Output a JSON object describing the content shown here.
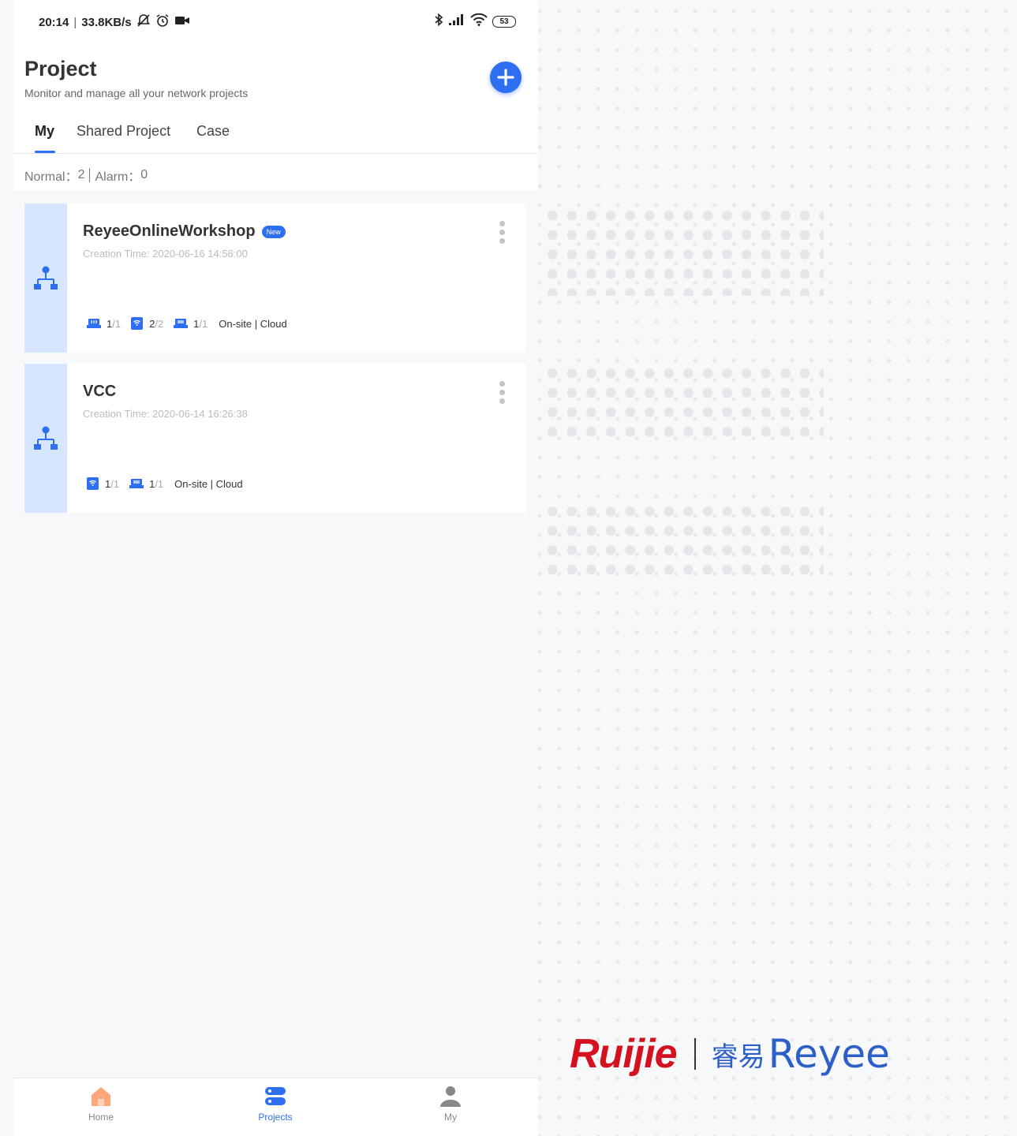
{
  "status_bar": {
    "time": "20:14",
    "speed": "33.8KB/s",
    "battery": "53",
    "icons": [
      "muted-bell-icon",
      "alarm-icon",
      "video-icon",
      "bluetooth-icon",
      "signal-icon",
      "wifi-icon",
      "battery-icon"
    ]
  },
  "header": {
    "title": "Project",
    "subtitle": "Monitor and manage all your network projects",
    "add_icon": "plus-icon"
  },
  "tabs": [
    {
      "label": "My",
      "active": true
    },
    {
      "label": "Shared Project",
      "active": false
    },
    {
      "label": "Case",
      "active": false
    }
  ],
  "summary": {
    "normal_label": "Normal：",
    "normal_value": "2",
    "alarm_label": "Alarm：",
    "alarm_value": "0"
  },
  "projects": [
    {
      "name": "ReyeeOnlineWorkshop",
      "badge": "New",
      "time": "Creation Time: 2020-06-16 14:56:00",
      "stats": [
        {
          "icon": "gateway-icon",
          "online": "1",
          "total": "/1"
        },
        {
          "icon": "access-point-icon",
          "online": "2",
          "total": "/2"
        },
        {
          "icon": "switch-icon",
          "online": "1",
          "total": "/1"
        }
      ],
      "mode": "On-site | Cloud"
    },
    {
      "name": "VCC",
      "time": "Creation Time: 2020-06-14 16:26:38",
      "stats": [
        {
          "icon": "access-point-icon",
          "online": "1",
          "total": "/1"
        },
        {
          "icon": "switch-icon",
          "online": "1",
          "total": "/1"
        }
      ],
      "mode": "On-site | Cloud"
    }
  ],
  "bottom_nav": [
    {
      "label": "Home",
      "icon": "home-icon",
      "active": false
    },
    {
      "label": "Projects",
      "icon": "projects-icon",
      "active": true
    },
    {
      "label": "My",
      "icon": "user-icon",
      "active": false
    }
  ],
  "branding": {
    "logo_left": "Ruijie",
    "logo_right": "Reyee",
    "logo_right_mark": "睿易",
    "accent_red": "#d4121f",
    "accent_blue": "#2e6ff2"
  }
}
